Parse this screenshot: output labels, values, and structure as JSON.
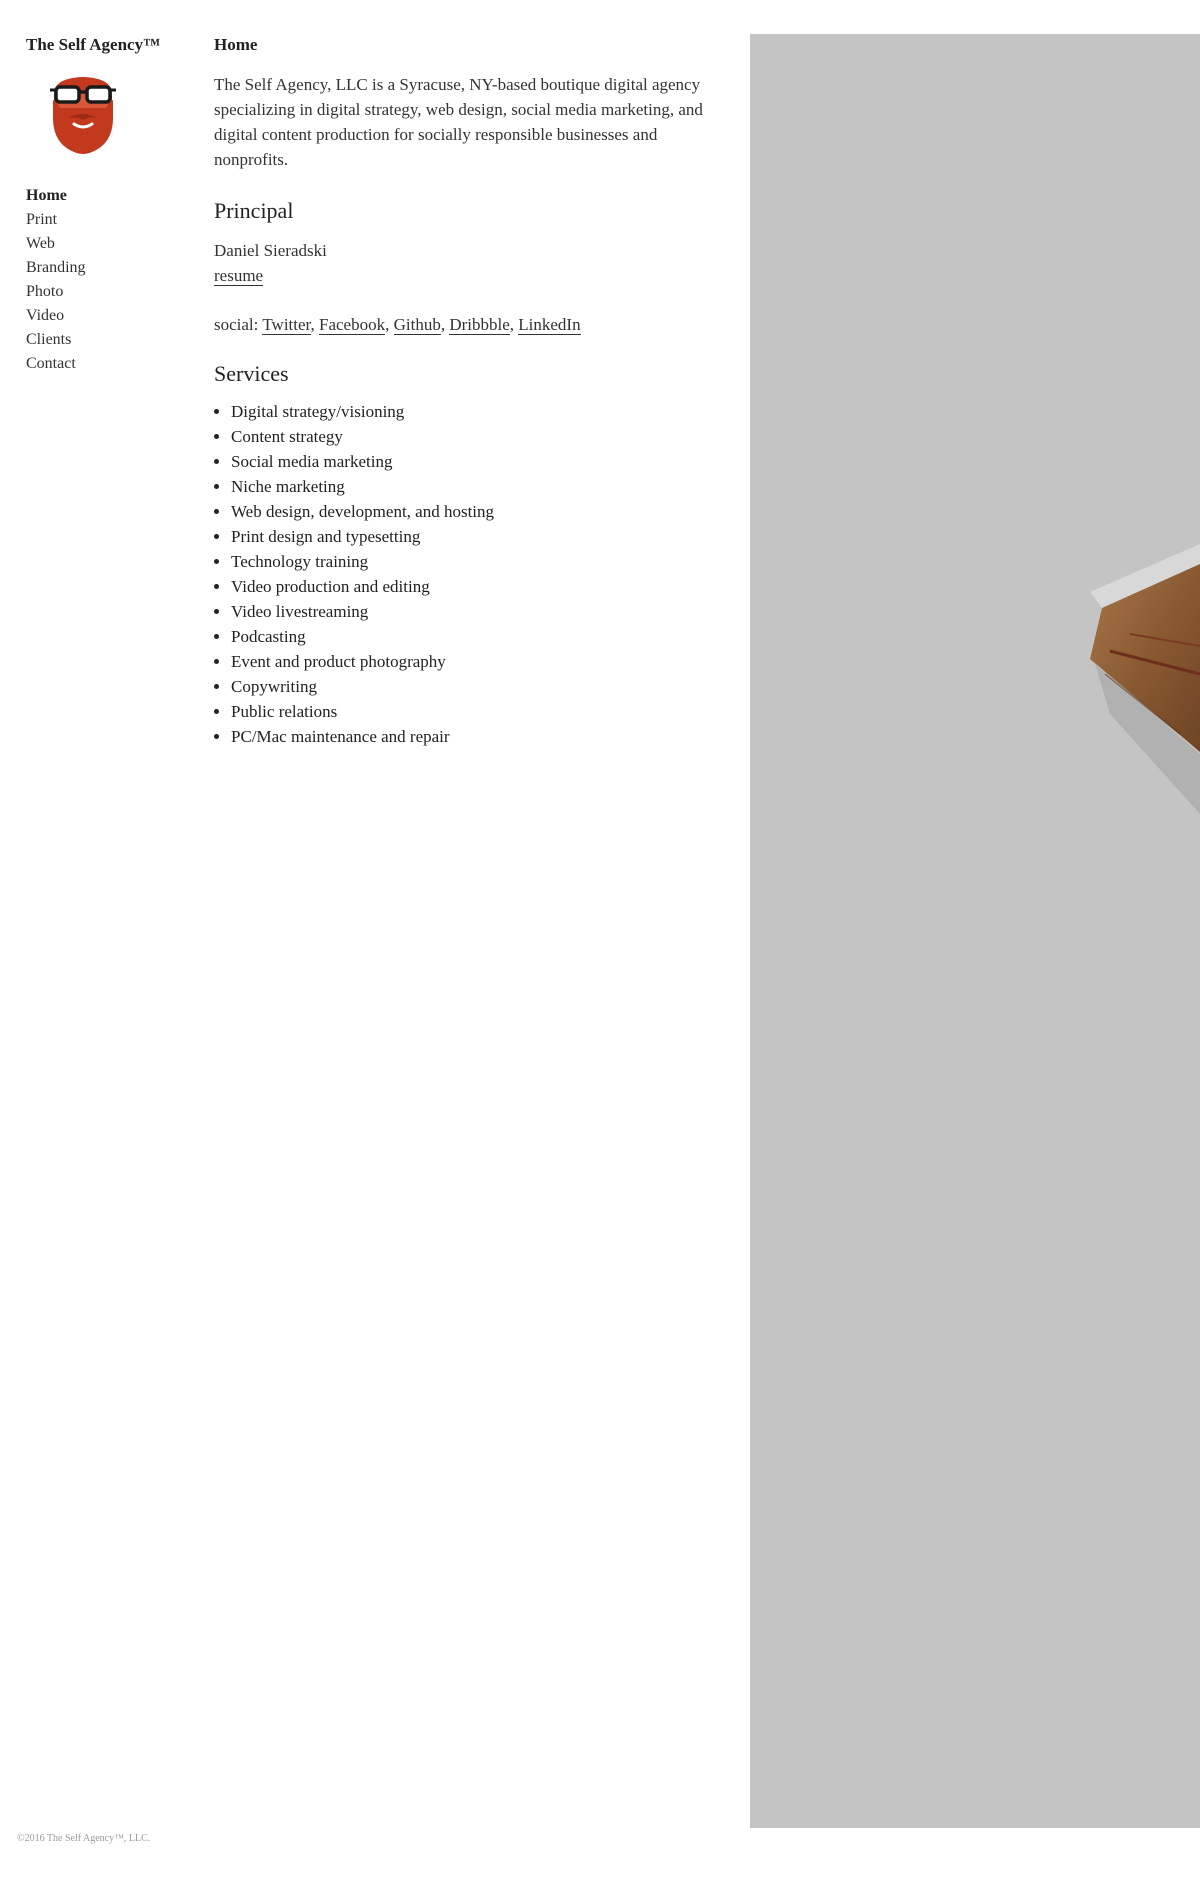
{
  "sidebar": {
    "site_title": "The Self Agency™",
    "logo_icon": "bearded-face-with-glasses-icon",
    "logo_color": "#c2391e",
    "nav": [
      {
        "label": "Home",
        "active": true
      },
      {
        "label": "Print",
        "active": false
      },
      {
        "label": "Web",
        "active": false
      },
      {
        "label": "Branding",
        "active": false
      },
      {
        "label": "Photo",
        "active": false
      },
      {
        "label": "Video",
        "active": false
      },
      {
        "label": "Clients",
        "active": false
      },
      {
        "label": "Contact",
        "active": false
      }
    ]
  },
  "main": {
    "page_heading": "Home",
    "intro": "The Self Agency, LLC is a Syracuse, NY-based boutique digital agency specializing in digital strategy, web design, social media marketing, and digital content production for socially responsible businesses and nonprofits.",
    "principal": {
      "heading": "Principal",
      "name": "Daniel Sieradski",
      "resume_label": "resume"
    },
    "social": {
      "prefix": "social:",
      "links": [
        "Twitter",
        "Facebook",
        "Github",
        "Dribbble",
        "LinkedIn"
      ]
    },
    "services": {
      "heading": "Services",
      "items": [
        "Digital strategy/visioning",
        "Content strategy",
        "Social media marketing",
        "Niche marketing",
        "Web design, development, and hosting",
        "Print design and typesetting",
        "Technology training",
        "Video production and editing",
        "Video livestreaming",
        "Podcasting",
        "Event and product photography",
        "Copywriting",
        "Public relations",
        "PC/Mac maintenance and repair"
      ]
    }
  },
  "hero": {
    "background_color": "#c4c4c4",
    "object_color": "#8a5a32"
  },
  "footer": {
    "text": "©2016 The Self Agency™, LLC."
  }
}
